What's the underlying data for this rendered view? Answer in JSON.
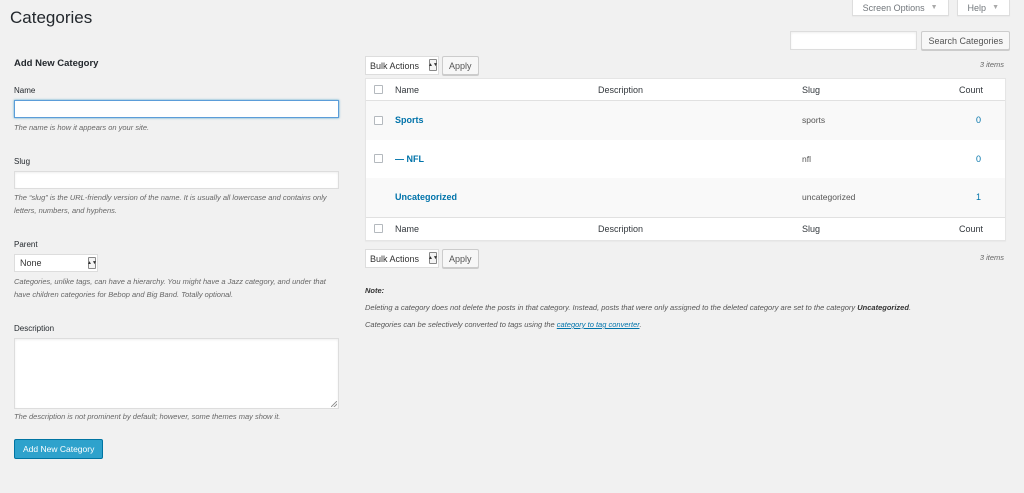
{
  "page_title": "Categories",
  "screen_meta": {
    "screen_options_label": "Screen Options",
    "help_label": "Help",
    "arrow_glyph": "▼"
  },
  "search": {
    "button_label": "Search Categories",
    "value": ""
  },
  "form": {
    "heading": "Add New Category",
    "name": {
      "label": "Name",
      "value": "",
      "help": "The name is how it appears on your site."
    },
    "slug": {
      "label": "Slug",
      "value": "",
      "help": "The “slug” is the URL-friendly version of the name. It is usually all lowercase and contains only letters, numbers, and hyphens."
    },
    "parent": {
      "label": "Parent",
      "selected": "None",
      "help": "Categories, unlike tags, can have a hierarchy. You might have a Jazz category, and under that have children categories for Bebop and Big Band. Totally optional."
    },
    "description": {
      "label": "Description",
      "value": "",
      "help": "The description is not prominent by default; however, some themes may show it."
    },
    "submit_label": "Add New Category"
  },
  "table": {
    "bulk_actions_label": "Bulk Actions",
    "apply_label": "Apply",
    "items_count": "3 items",
    "columns": {
      "name": "Name",
      "description": "Description",
      "slug": "Slug",
      "count": "Count"
    },
    "rows": [
      {
        "name": "Sports",
        "description": "",
        "slug": "sports",
        "count": "0"
      },
      {
        "name": "— NFL",
        "description": "",
        "slug": "nfl",
        "count": "0"
      },
      {
        "name": "Uncategorized",
        "description": "",
        "slug": "uncategorized",
        "count": "1"
      }
    ]
  },
  "note": {
    "label": "Note:",
    "line1_prefix": "Deleting a category does not delete the posts in that category. Instead, posts that were only assigned to the deleted category are set to the category ",
    "line1_bold": "Uncategorized",
    "line1_suffix": ".",
    "line2_prefix": "Categories can be selectively converted to tags using the ",
    "line2_link": "category to tag converter",
    "line2_suffix": "."
  },
  "colors": {
    "link": "#0073aa",
    "primary_button": "#2ea2cc",
    "background": "#f1f1f1"
  }
}
